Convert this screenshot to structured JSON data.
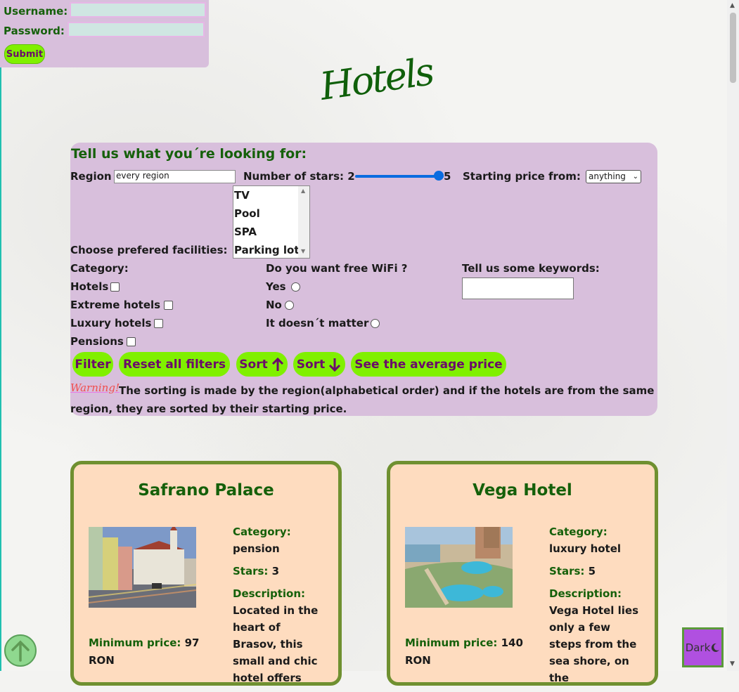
{
  "login": {
    "username_label": "Username:",
    "password_label": "Password:",
    "submit_label": "Submit"
  },
  "page_title": "Hotels",
  "filters": {
    "heading": "Tell us what you´re looking for:",
    "region_label": "Region",
    "region_value": "every region",
    "stars_label": "Number of stars: 2",
    "stars_max": "5",
    "stars_level": 5,
    "price_label": "Starting price from:",
    "price_selected": "anything",
    "facilities_label": "Choose prefered facilities:",
    "facilities": [
      "TV",
      "Pool",
      "SPA",
      "Parking lot"
    ],
    "category_label": "Category:",
    "categories": [
      "Hotels",
      "Extreme hotels",
      "Luxury hotels",
      "Pensions"
    ],
    "wifi_label": "Do you want free WiFi ?",
    "wifi_options": [
      "Yes",
      "No",
      "It doesn´t matter"
    ],
    "keywords_label": "Tell us some keywords:",
    "buttons": {
      "filter": "Filter",
      "reset": "Reset all filters",
      "sort_up": "Sort",
      "sort_down": "Sort",
      "average": "See the average price"
    },
    "warning_word": "Warning!",
    "warning_text": "The sorting is made by the region(alphabetical order) and if the hotels are from the same region, they are sorted by their starting price."
  },
  "hotels": [
    {
      "name": "Safrano Palace",
      "category_label": "Category:",
      "category": "pension",
      "stars_label": "Stars:",
      "stars": "3",
      "description_label": "Description:",
      "description": "Located in the heart of Brasov, this small and chic hotel offers",
      "min_price_label": "Minimum price:",
      "min_price": "97 RON"
    },
    {
      "name": "Vega Hotel",
      "category_label": "Category:",
      "category": "luxury hotel",
      "stars_label": "Stars:",
      "stars": "5",
      "description_label": "Description:",
      "description": "Vega Hotel lies only a few steps from the sea shore, on the",
      "min_price_label": "Minimum price:",
      "min_price": "140 RON"
    }
  ],
  "dark_button": "Dark",
  "colors": {
    "panel": "#d8bfdc",
    "accent_green": "#80f000",
    "title_green": "#15600a",
    "card": "#fedcbf",
    "card_border": "#6f9030"
  }
}
